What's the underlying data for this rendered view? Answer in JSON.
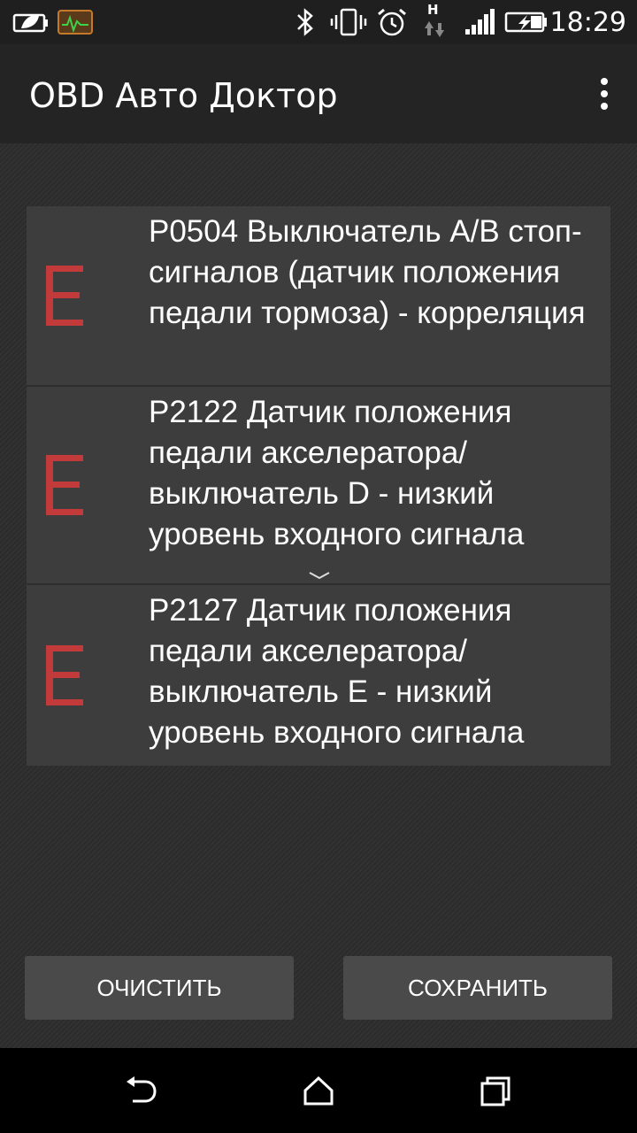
{
  "status_bar": {
    "time": "18:29",
    "icons": [
      "battery-saver-icon",
      "obd-monitor-icon",
      "bluetooth-icon",
      "vibrate-icon",
      "alarm-icon",
      "network-type-icon",
      "signal-icon",
      "battery-charging-icon"
    ],
    "network_label": "H"
  },
  "app_bar": {
    "title": "OBD Авто Доктор"
  },
  "errors": [
    {
      "level_icon": "E",
      "text": "P0504 Выключатель A/B стоп-сигналов (датчик положения педали тормоза) - корреляция"
    },
    {
      "level_icon": "E",
      "text": "P2122 Датчик положения педали акселератора/ выключатель D - низкий уровень входного сигнала"
    },
    {
      "level_icon": "E",
      "text": "P2127 Датчик положения педали акселератора/ выключатель E - низкий уровень входного сигнала"
    }
  ],
  "actions": {
    "clear_label": "ОЧИСТИТЬ",
    "save_label": "СОХРАНИТЬ"
  },
  "colors": {
    "error_icon": "#c23a3a",
    "item_bg": "#3d3d3d",
    "button_bg": "#4a4a4a"
  }
}
